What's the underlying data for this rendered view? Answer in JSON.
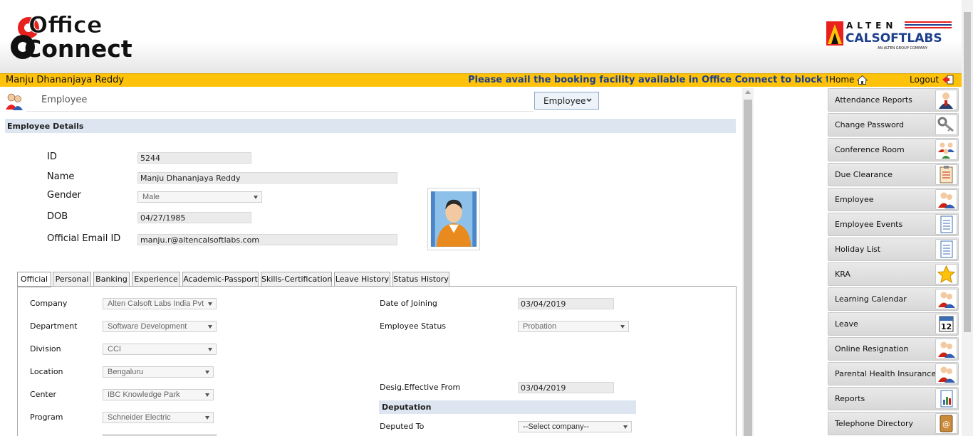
{
  "header": {
    "user_name": "Manju Dhananjaya Reddy",
    "announcement": "Please avail the booking facility available in Office Connect to block the Conf",
    "home_label": "Home",
    "logout_label": "Logout",
    "icons": {
      "home": "home-icon",
      "logout": "logout-icon"
    }
  },
  "page": {
    "title": "Employee",
    "module_select": "Employee"
  },
  "employee_details": {
    "section_title": "Employee Details",
    "id_label": "ID",
    "id_value": "5244",
    "name_label": "Name",
    "name_value": "Manju Dhananjaya Reddy",
    "gender_label": "Gender",
    "gender_value": "Male",
    "dob_label": "DOB",
    "dob_value": "04/27/1985",
    "email_label": "Official Email ID",
    "email_value": "manju.r@altencalsoftlabs.com"
  },
  "tabs": [
    {
      "label": "Official"
    },
    {
      "label": "Personal"
    },
    {
      "label": "Banking"
    },
    {
      "label": "Experience"
    },
    {
      "label": "Academic-Passport"
    },
    {
      "label": "Skills-Certification"
    },
    {
      "label": "Leave History"
    },
    {
      "label": "Status History"
    }
  ],
  "official": {
    "company_label": "Company",
    "company_value": "Alten Calsoft Labs India Pvt",
    "department_label": "Department",
    "department_value": "Software Development",
    "division_label": "Division",
    "division_value": "CCI",
    "location_label": "Location",
    "location_value": "Bengaluru",
    "center_label": "Center",
    "center_value": "IBC Knowledge Park",
    "program_label": "Program",
    "program_value": "Schneider Electric",
    "doj_label": "Date of Joining",
    "doj_value": "03/04/2019",
    "status_label": "Employee Status",
    "status_value": "Probation",
    "desig_label": "Desig.Effective From",
    "desig_value": "03/04/2019",
    "deputation_title": "Deputation",
    "deputed_label": "Deputed To",
    "deputed_value": "--Select company--"
  },
  "menu": {
    "items": [
      {
        "label": "Attendance Reports",
        "icon": "person-report-icon"
      },
      {
        "label": "Change Password",
        "icon": "key-icon"
      },
      {
        "label": "Conference Room",
        "icon": "people-group-icon"
      },
      {
        "label": "Due Clearance",
        "icon": "clipboard-icon"
      },
      {
        "label": "Employee",
        "icon": "employees-icon"
      },
      {
        "label": "Employee Events",
        "icon": "document-icon"
      },
      {
        "label": "Holiday List",
        "icon": "document-icon"
      },
      {
        "label": "KRA",
        "icon": "star-icon"
      },
      {
        "label": "Learning Calendar",
        "icon": "employees-icon"
      },
      {
        "label": "Leave",
        "icon": "calendar-icon"
      },
      {
        "label": "Online Resignation",
        "icon": "employees-icon"
      },
      {
        "label": "Parental Health Insurance",
        "icon": "employees-icon"
      },
      {
        "label": "Reports",
        "icon": "chart-report-icon"
      },
      {
        "label": "Telephone Directory",
        "icon": "address-book-icon"
      }
    ],
    "calendar_day": "12"
  },
  "colors": {
    "yellow_bar": "#ffc20a",
    "announcement_text": "#1d3f8c",
    "section_header": "#dde6f0",
    "logo_red": "#e8201e"
  }
}
